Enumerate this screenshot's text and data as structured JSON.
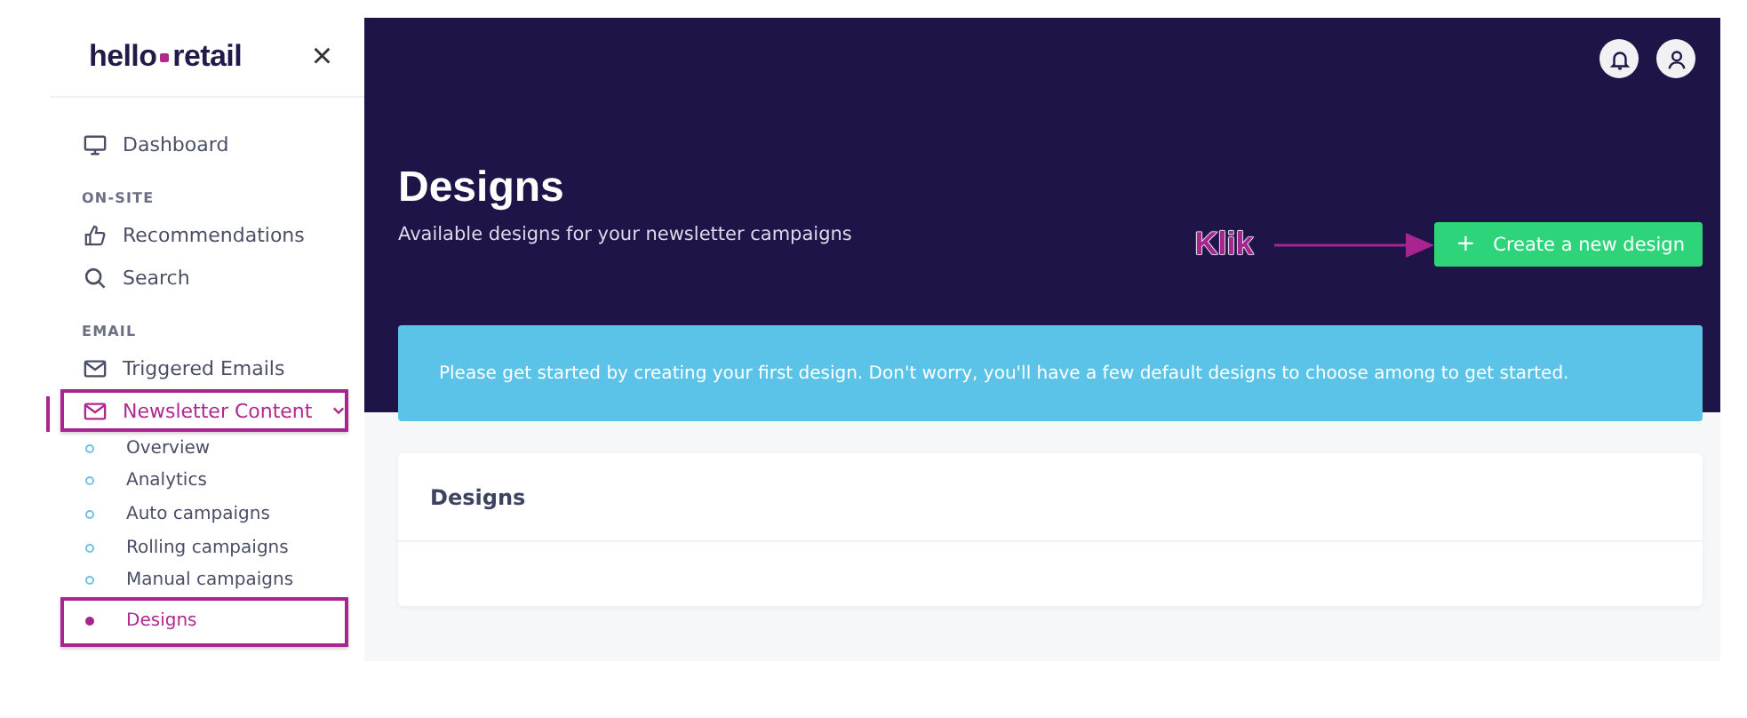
{
  "sidebar": {
    "logo": {
      "left": "hello",
      "right": "retail"
    },
    "close": "×",
    "sections": [
      {
        "items": [
          {
            "label": "Dashboard",
            "kind": "monitor",
            "selected": false,
            "highlighted": false
          }
        ]
      },
      {
        "heading": "ON-SITE",
        "items": [
          {
            "label": "Recommendations",
            "kind": "thumb",
            "selected": false,
            "highlighted": false
          },
          {
            "label": "Search",
            "kind": "search",
            "selected": false,
            "highlighted": false
          }
        ]
      },
      {
        "heading": "EMAIL",
        "items": [
          {
            "label": "Triggered Emails",
            "kind": "mail",
            "selected": false,
            "highlighted": false
          },
          {
            "label": "Newsletter Content",
            "kind": "mail",
            "selected": true,
            "expanded": true,
            "highlighted": true,
            "children": [
              {
                "label": "Overview",
                "selected": false,
                "highlighted": false
              },
              {
                "label": "Analytics",
                "selected": false,
                "highlighted": false
              },
              {
                "label": "Auto campaigns",
                "selected": false,
                "highlighted": false
              },
              {
                "label": "Rolling campaigns",
                "selected": false,
                "highlighted": false
              },
              {
                "label": "Manual campaigns",
                "selected": false,
                "highlighted": false
              },
              {
                "label": "Designs",
                "selected": true,
                "highlighted": true
              }
            ]
          }
        ]
      }
    ]
  },
  "header": {
    "title": "Designs",
    "subtitle": "Available designs for your newsletter campaigns",
    "button": {
      "icon": "+",
      "label": "Create a new design"
    },
    "annotation": {
      "label": "Klik"
    }
  },
  "notice": "Please get started by creating your first design. Don't worry, you'll have a few default designs to choose among to get started.",
  "card": {
    "title": "Designs"
  }
}
